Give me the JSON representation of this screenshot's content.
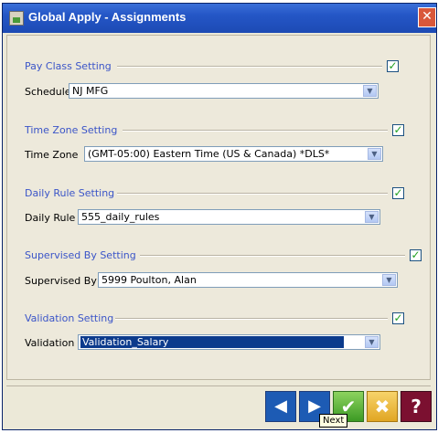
{
  "window": {
    "title": "Global Apply - Assignments",
    "close_label": "✕"
  },
  "sections": {
    "pay_class": {
      "title": "Pay Class Setting",
      "checked": true,
      "field_label": "Schedule",
      "field_value": "NJ MFG"
    },
    "time_zone": {
      "title": "Time Zone Setting",
      "checked": true,
      "field_label": "Time Zone",
      "field_value": "(GMT-05:00) Eastern Time (US & Canada) *DLS*"
    },
    "daily_rule": {
      "title": "Daily Rule Setting",
      "checked": true,
      "field_label": "Daily Rule",
      "field_value": "555_daily_rules"
    },
    "supervised_by": {
      "title": "Supervised By Setting",
      "checked": true,
      "field_label": "Supervised By",
      "field_value": "5999 Poulton, Alan"
    },
    "validation": {
      "title": "Validation Setting",
      "checked": true,
      "field_label": "Validation",
      "field_value": "Validation_Salary"
    }
  },
  "footer": {
    "prev_glyph": "◀",
    "next_glyph": "▶",
    "ok_glyph": "✔",
    "cancel_glyph": "✖",
    "help_glyph": "?",
    "tooltip": "Next"
  },
  "colors": {
    "title_bar": "#2456c6",
    "section_title": "#3b55c8",
    "selected_value_bg": "#0b3a8c",
    "help_button": "#7b1030"
  },
  "icons": [
    "app-icon",
    "close-icon",
    "checkbox-check-icon",
    "dropdown-arrow-icon",
    "previous-arrow-icon",
    "next-arrow-icon",
    "ok-check-icon",
    "cancel-x-icon",
    "help-question-icon"
  ]
}
